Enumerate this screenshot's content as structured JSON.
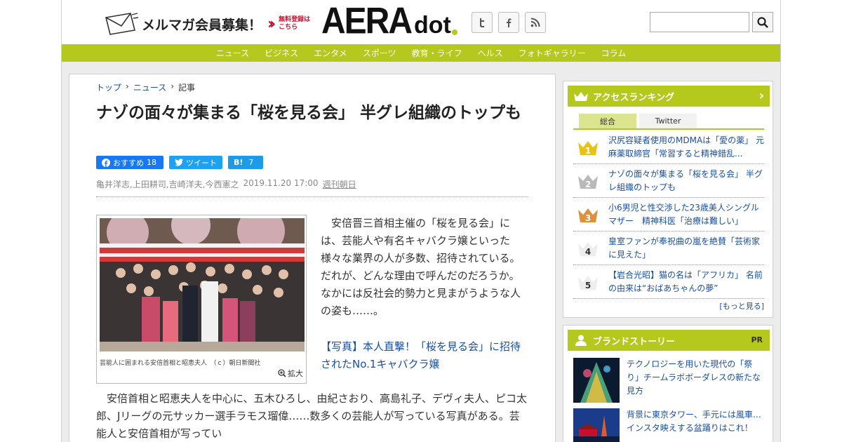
{
  "header": {
    "mailmag_label": "メルマガ会員募集！",
    "free_reg_label": "無料登録はこちら",
    "logo_main": "AERA",
    "logo_sub": "dot",
    "social": [
      {
        "name": "twitter-icon",
        "glyph": "t"
      },
      {
        "name": "facebook-icon",
        "glyph": "f"
      },
      {
        "name": "rss-icon",
        "glyph": "))"
      }
    ],
    "search_placeholder": ""
  },
  "nav": {
    "items": [
      "ニュース",
      "ビジネス",
      "エンタメ",
      "スポーツ",
      "教育・ライフ",
      "ヘルス",
      "フォトギャラリー",
      "コラム"
    ]
  },
  "article": {
    "breadcrumb": {
      "home": "トップ",
      "section": "ニュース",
      "current": "記事"
    },
    "title": "ナゾの面々が集まる「桜を見る会」 半グレ組織のトップも",
    "share": {
      "fb_label": "おすすめ",
      "fb_count": "18",
      "tw_label": "ツイート",
      "hb_label": "B!",
      "hb_count": "7"
    },
    "authors": "亀井洋志,上田耕司,吉崎洋夫,今西憲之",
    "date": "2019.11.20 17:00",
    "magazine": "週刊朝日",
    "photo_caption": "芸能人に囲まれる安倍首相と昭恵夫人　（ｃ）朝日新聞社",
    "zoom_label": "拡大",
    "lead": "　安倍晋三首相主催の「桜を見る会」には、芸能人や有名キャバクラ嬢といった様々な業界の人が多数、招待されている。だれが、どんな理由で呼んだのだろうか。なかには反社会的勢力と見まがうような人の姿も……。",
    "photo_link": "【写真】本人直撃！「桜を見る会」に招待されたNo.1キャバクラ嬢",
    "body": "　安倍首相と昭恵夫人を中心に、五木ひろし、由紀さおり、高島礼子、デヴィ夫人、ピコ太郎、Jリーグの元サッカー選手ラモス瑠偉……数多くの芸能人が写っている写真がある。芸能人と安倍首相が写ってい"
  },
  "ranking": {
    "title": "アクセスランキング",
    "tabs": [
      "総合",
      "Twitter"
    ],
    "items": [
      {
        "rank": "1",
        "text": "沢尻容疑者使用のMDMAは「愛の薬」 元麻薬取締官「常習すると精神錯乱..."
      },
      {
        "rank": "2",
        "text": "ナゾの面々が集まる「桜を見る会」 半グレ組織のトップも"
      },
      {
        "rank": "3",
        "text": "小6男児と性交渉した23歳美人シングルマザー　精神科医「治療は難しい」"
      },
      {
        "rank": "4",
        "text": "皇室ファンが奉祝曲の嵐を絶賛「芸術家に見えた」"
      },
      {
        "rank": "5",
        "text": "【岩合光昭】猫の名は「アフリカ」 名前の由来は“おばあちゃんの夢”"
      }
    ],
    "more": "[もっと見る]"
  },
  "brand": {
    "title": "ブランドストーリー",
    "pr": "PR",
    "items": [
      {
        "text": "テクノロジーを用いた現代の「祭り」チームラボボーダレスの新たな見方"
      },
      {
        "text": "背景に東京タワー、手元には風車…インスタ映えする盆踊りはこれ！"
      }
    ]
  },
  "colors": {
    "accent": "#b4c81e",
    "link": "#1a4fa0",
    "brand_red": "#c8102e"
  }
}
